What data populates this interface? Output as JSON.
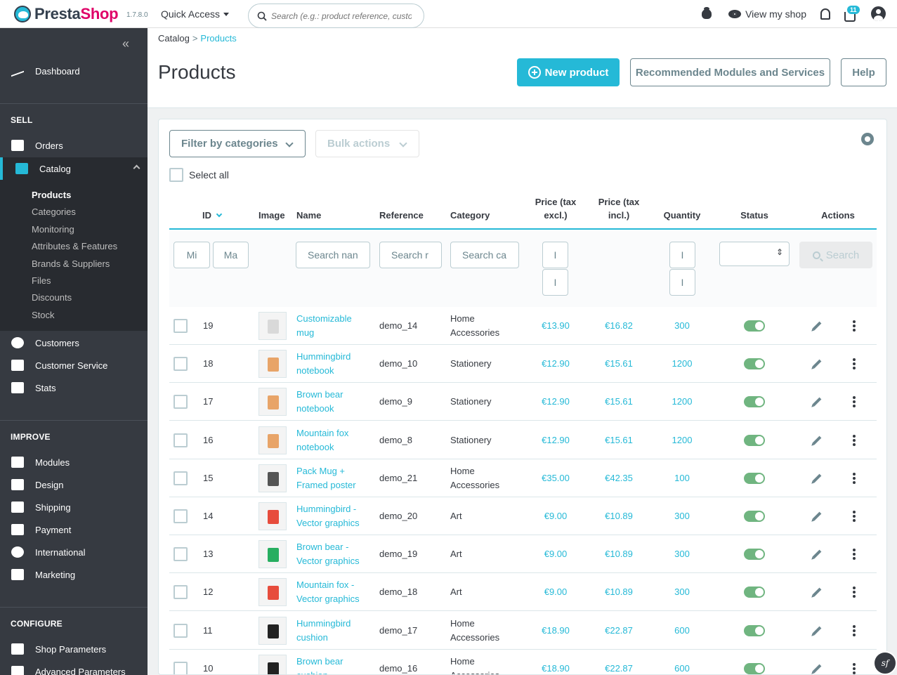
{
  "topbar": {
    "logo_text": "PrestaShop",
    "version": "1.7.8.0",
    "quick_access": "Quick Access",
    "search_placeholder": "Search (e.g.: product reference, custon",
    "view_shop": "View my shop",
    "cart_badge": "11"
  },
  "sidebar": {
    "dashboard": "Dashboard",
    "sell_title": "SELL",
    "orders": "Orders",
    "catalog": "Catalog",
    "catalog_sub": [
      "Products",
      "Categories",
      "Monitoring",
      "Attributes & Features",
      "Brands & Suppliers",
      "Files",
      "Discounts",
      "Stock"
    ],
    "customers": "Customers",
    "customer_service": "Customer Service",
    "stats": "Stats",
    "improve_title": "IMPROVE",
    "modules": "Modules",
    "design": "Design",
    "shipping": "Shipping",
    "payment": "Payment",
    "international": "International",
    "marketing": "Marketing",
    "configure_title": "CONFIGURE",
    "shop_parameters": "Shop Parameters",
    "advanced_parameters": "Advanced Parameters"
  },
  "header": {
    "breadcrumb_parent": "Catalog",
    "breadcrumb_current": "Products",
    "title": "Products",
    "new_product": "New product",
    "recommended": "Recommended Modules and Services",
    "help": "Help"
  },
  "toolbar": {
    "filter_categories": "Filter by categories",
    "bulk_actions": "Bulk actions",
    "select_all": "Select all"
  },
  "table": {
    "headers": {
      "id": "ID",
      "image": "Image",
      "name": "Name",
      "reference": "Reference",
      "category": "Category",
      "price_excl_1": "Price (tax",
      "price_excl_2": "excl.)",
      "price_incl_1": "Price (tax",
      "price_incl_2": "incl.)",
      "quantity": "Quantity",
      "status": "Status",
      "actions": "Actions"
    },
    "filters": {
      "id_min": "Mi",
      "id_max": "Ma",
      "name": "Search nan",
      "reference": "Search r",
      "category": "Search ca",
      "price_min": "I",
      "price_max": "I",
      "qty_min": "I",
      "qty_max": "I",
      "search_button": "Search"
    },
    "rows": [
      {
        "id": "19",
        "name1": "Customizable",
        "name2": "mug",
        "ref": "demo_14",
        "cat1": "Home",
        "cat2": "Accessories",
        "excl": "€13.90",
        "incl": "€16.82",
        "qty": "300",
        "color": "#d9d9d9"
      },
      {
        "id": "18",
        "name1": "Hummingbird",
        "name2": "notebook",
        "ref": "demo_10",
        "cat1": "Stationery",
        "cat2": "",
        "excl": "€12.90",
        "incl": "€15.61",
        "qty": "1200",
        "color": "#e8a468"
      },
      {
        "id": "17",
        "name1": "Brown bear",
        "name2": "notebook",
        "ref": "demo_9",
        "cat1": "Stationery",
        "cat2": "",
        "excl": "€12.90",
        "incl": "€15.61",
        "qty": "1200",
        "color": "#e8a468"
      },
      {
        "id": "16",
        "name1": "Mountain fox",
        "name2": "notebook",
        "ref": "demo_8",
        "cat1": "Stationery",
        "cat2": "",
        "excl": "€12.90",
        "incl": "€15.61",
        "qty": "1200",
        "color": "#e8a468"
      },
      {
        "id": "15",
        "name1": "Pack Mug +",
        "name2": "Framed poster",
        "ref": "demo_21",
        "cat1": "Home",
        "cat2": "Accessories",
        "excl": "€35.00",
        "incl": "€42.35",
        "qty": "100",
        "color": "#555555"
      },
      {
        "id": "14",
        "name1": "Hummingbird -",
        "name2": "Vector graphics",
        "ref": "demo_20",
        "cat1": "Art",
        "cat2": "",
        "excl": "€9.00",
        "incl": "€10.89",
        "qty": "300",
        "color": "#e74c3c"
      },
      {
        "id": "13",
        "name1": "Brown bear -",
        "name2": "Vector graphics",
        "ref": "demo_19",
        "cat1": "Art",
        "cat2": "",
        "excl": "€9.00",
        "incl": "€10.89",
        "qty": "300",
        "color": "#27ae60"
      },
      {
        "id": "12",
        "name1": "Mountain fox -",
        "name2": "Vector graphics",
        "ref": "demo_18",
        "cat1": "Art",
        "cat2": "",
        "excl": "€9.00",
        "incl": "€10.89",
        "qty": "300",
        "color": "#e74c3c"
      },
      {
        "id": "11",
        "name1": "Hummingbird",
        "name2": "cushion",
        "ref": "demo_17",
        "cat1": "Home",
        "cat2": "Accessories",
        "excl": "€18.90",
        "incl": "€22.87",
        "qty": "600",
        "color": "#222222"
      },
      {
        "id": "10",
        "name1": "Brown bear",
        "name2": "cushion",
        "ref": "demo_16",
        "cat1": "Home",
        "cat2": "Accessories",
        "excl": "€18.90",
        "incl": "€22.87",
        "qty": "600",
        "color": "#222222"
      }
    ]
  },
  "colors": {
    "accent": "#25b9d7",
    "sidebar_bg": "#363a41",
    "status_on": "#70b580"
  },
  "footer_badge": "sf"
}
